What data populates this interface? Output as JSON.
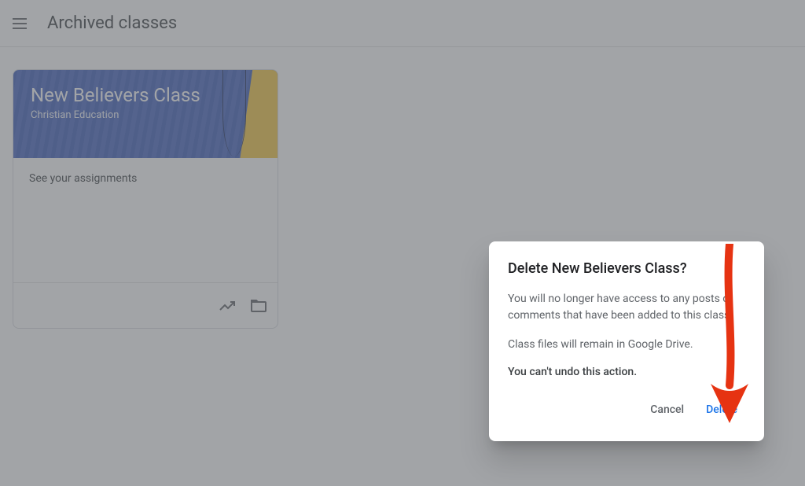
{
  "header": {
    "title": "Archived classes"
  },
  "card": {
    "title": "New Believers Class",
    "subtitle": "Christian Education",
    "assignments_link": "See your assignments"
  },
  "dialog": {
    "title": "Delete New Believers Class?",
    "body_1": "You will no longer have access to any posts or comments that have been added to this class.",
    "body_2": "Class files will remain in Google Drive.",
    "warning": "You can't undo this action.",
    "cancel_label": "Cancel",
    "delete_label": "Delete"
  }
}
